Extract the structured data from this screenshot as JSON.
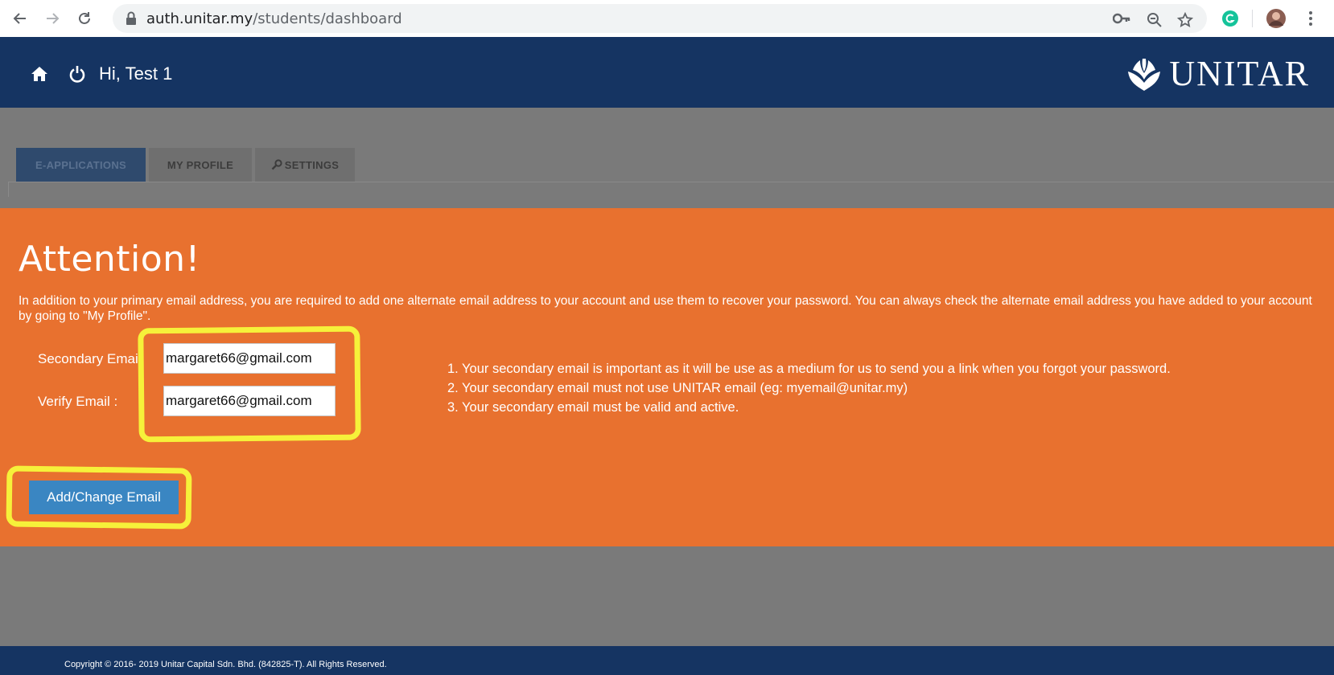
{
  "browser": {
    "url_domain": "auth.unitar.my",
    "url_path": "/students/dashboard"
  },
  "header": {
    "greeting": "Hi, Test 1",
    "logo_text": "UNITAR"
  },
  "tabs": [
    {
      "label": "E-APPLICATIONS",
      "active": true
    },
    {
      "label": "MY PROFILE",
      "active": false
    },
    {
      "label": "SETTINGS",
      "active": false
    }
  ],
  "modal": {
    "title": "Attention!",
    "intro": "In addition to your primary email address, you are required to add one alternate email address to your account and use them to recover your password. You can always check the alternate email address you have added to your account by going to \"My Profile\".",
    "secondary_label": "Secondary Email",
    "secondary_value": "margaret66@gmail.com",
    "verify_label": "Verify Email :",
    "verify_value": "margaret66@gmail.com",
    "submit_label": "Add/Change Email",
    "rules": [
      "1. Your secondary email is important as it will be use as a medium for us to send you a link when you forgot your password.",
      "2. Your secondary email must not use UNITAR email (eg: myemail@unitar.my)",
      "3. Your secondary email must be valid and active."
    ]
  },
  "footer": {
    "copyright": "Copyright © 2016- 2019 Unitar Capital Sdn. Bhd. (842825-T). All Rights Reserved."
  },
  "colors": {
    "brand_navy": "#153462",
    "modal_orange": "#e8712f",
    "button_blue": "#3a86c2",
    "highlight_yellow": "#f6f13a"
  }
}
